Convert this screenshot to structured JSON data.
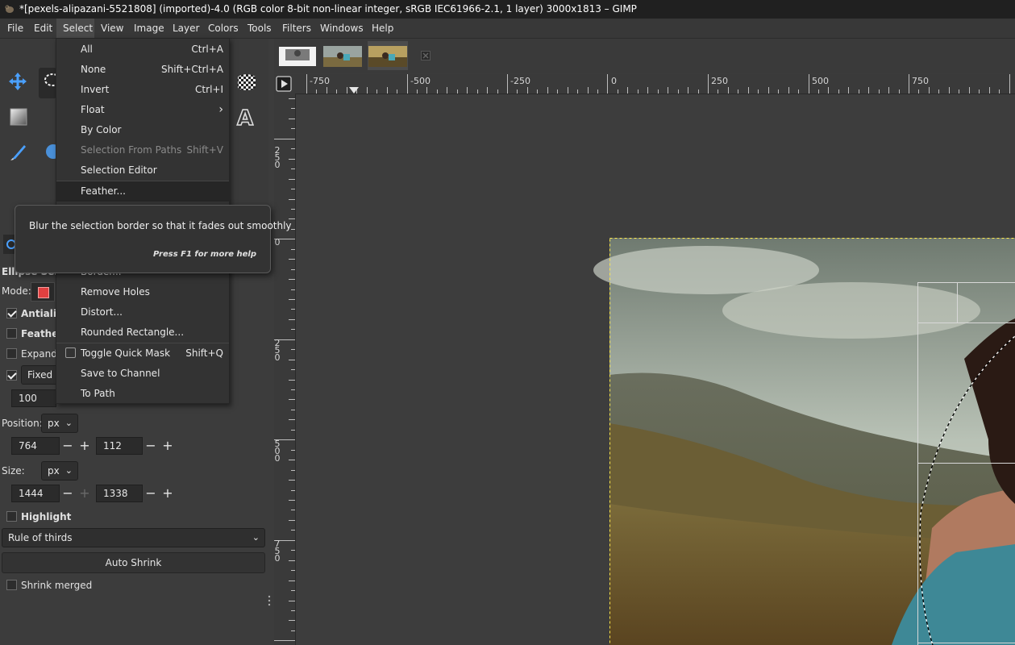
{
  "window": {
    "title": "*[pexels-alipazani-5521808] (imported)-4.0 (RGB color 8-bit non-linear integer, sRGB IEC61966-2.1, 1 layer) 3000x1813 – GIMP"
  },
  "menubar": {
    "items": [
      "File",
      "Edit",
      "Select",
      "View",
      "Image",
      "Layer",
      "Colors",
      "Tools",
      "Filters",
      "Windows",
      "Help"
    ],
    "active": "Select"
  },
  "select_menu": {
    "items": [
      {
        "label": "All",
        "shortcut": "Ctrl+A",
        "enabled": true
      },
      {
        "label": "None",
        "shortcut": "Shift+Ctrl+A",
        "enabled": true
      },
      {
        "label": "Invert",
        "shortcut": "Ctrl+I",
        "enabled": true
      },
      {
        "label": "Float",
        "shortcut": "",
        "enabled": true,
        "submenu": true
      },
      {
        "label": "By Color",
        "shortcut": "",
        "enabled": true
      },
      {
        "label": "Selection From Paths",
        "shortcut": "Shift+V",
        "enabled": false
      },
      {
        "label": "Selection Editor",
        "shortcut": "",
        "enabled": true
      },
      {
        "label": "Feather...",
        "shortcut": "",
        "enabled": true,
        "highlighted": true
      },
      {
        "label": "Border...",
        "shortcut": "",
        "enabled": true
      },
      {
        "label": "Remove Holes",
        "shortcut": "",
        "enabled": true
      },
      {
        "label": "Distort...",
        "shortcut": "",
        "enabled": true
      },
      {
        "label": "Rounded Rectangle...",
        "shortcut": "",
        "enabled": true
      },
      {
        "label": "Toggle Quick Mask",
        "shortcut": "Shift+Q",
        "enabled": true,
        "checkbox": true
      },
      {
        "label": "Save to Channel",
        "shortcut": "",
        "enabled": true
      },
      {
        "label": "To Path",
        "shortcut": "",
        "enabled": true
      }
    ]
  },
  "tooltip": {
    "text": "Blur the selection border so that it fades out smoothly",
    "help": "Press F1 for more help"
  },
  "tool_options": {
    "title": "Ellipse Select",
    "mode_label": "Mode:",
    "antialiasing_label": "Antialiasing",
    "antialiasing": true,
    "feather_label": "Feather edges",
    "feather": false,
    "expand_label": "Expand from center",
    "expand": false,
    "fixed_checked": true,
    "fixed_label": "Fixed",
    "fixed_value": "100",
    "position_label": "Position:",
    "position_unit": "px",
    "position_x": "764",
    "position_y": "112",
    "size_label": "Size:",
    "size_unit": "px",
    "size_w": "1444",
    "size_h": "1338",
    "highlight_label": "Highlight",
    "highlight": false,
    "guides": "Rule of thirds",
    "auto_shrink_label": "Auto Shrink",
    "shrink_merged_label": "Shrink merged",
    "shrink_merged": false
  },
  "rulers": {
    "horizontal": [
      "-750",
      "-500",
      "-250",
      "0",
      "250",
      "500",
      "750"
    ],
    "vertical": [
      "250",
      "0",
      "250",
      "500",
      "750"
    ]
  },
  "colors": {
    "accent_blue": "#2b7bd6",
    "mode_red": "#e04040",
    "selection_yellow": "#ffe94a"
  }
}
